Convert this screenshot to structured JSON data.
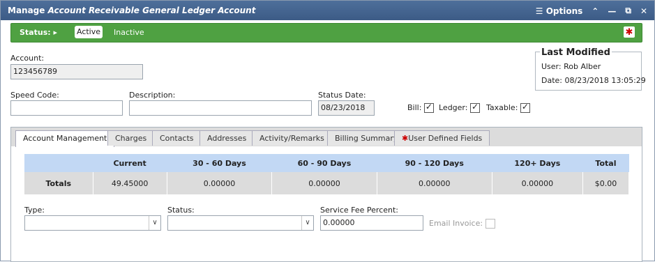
{
  "window": {
    "title_prefix": "Manage ",
    "title_italic": "Account Receivable General Ledger Account",
    "options_label": "Options"
  },
  "status": {
    "label": "Status:",
    "active": "Active",
    "inactive": "Inactive"
  },
  "form": {
    "account_label": "Account:",
    "account_value": "123456789",
    "speed_code_label": "Speed Code:",
    "speed_code_value": "",
    "description_label": "Description:",
    "description_value": "",
    "status_date_label": "Status Date:",
    "status_date_value": "08/23/2018",
    "bill_label": "Bill:",
    "ledger_label": "Ledger:",
    "taxable_label": "Taxable:"
  },
  "last_modified": {
    "title": "Last Modified",
    "user": "User: Rob Alber",
    "date": "Date: 08/23/2018 13:05:29"
  },
  "tabs": [
    {
      "label": "Account Management"
    },
    {
      "label": "Charges"
    },
    {
      "label": "Contacts"
    },
    {
      "label": "Addresses"
    },
    {
      "label": "Activity/Remarks"
    },
    {
      "label": "Billing Summary"
    },
    {
      "label": "User Defined Fields"
    }
  ],
  "aging": {
    "headers": [
      "",
      "Current",
      "30 - 60 Days",
      "60 - 90 Days",
      "90 - 120 Days",
      "120+ Days",
      "Total"
    ],
    "totals_label": "Totals",
    "totals": [
      "49.45000",
      "0.00000",
      "0.00000",
      "0.00000",
      "0.00000",
      "$0.00"
    ]
  },
  "management": {
    "type_label": "Type:",
    "type_value": "",
    "status_label": "Status:",
    "status_value": "",
    "service_fee_label": "Service Fee Percent:",
    "service_fee_value": "0.00000",
    "email_invoice_label": "Email Invoice:"
  }
}
